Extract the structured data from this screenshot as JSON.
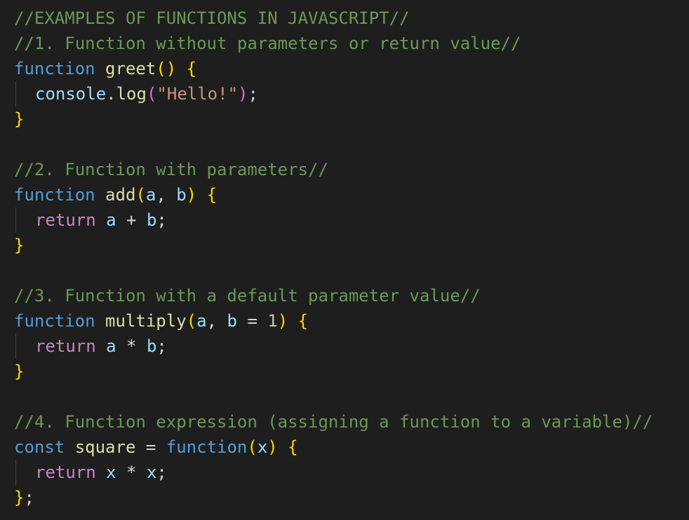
{
  "comments": {
    "title": "//EXAMPLES OF FUNCTIONS IN JAVASCRIPT//",
    "c1": "//1. Function without parameters or return value//",
    "c2": "//2. Function with parameters//",
    "c3": "//3. Function with a default parameter value//",
    "c4": "//4. Function expression (assigning a function to a variable)//"
  },
  "tokens": {
    "kw_function": "function",
    "kw_return": "return",
    "kw_const": "const",
    "fn_greet": "greet",
    "fn_add": "add",
    "fn_multiply": "multiply",
    "fn_square": "square",
    "var_console": "console",
    "fn_log": "log",
    "str_hello": "\"Hello!\"",
    "param_a": "a",
    "param_b": "b",
    "param_x": "x",
    "num_one": "1"
  },
  "colors": {
    "background": "#1e1e1e",
    "comment": "#6a9955",
    "keyword": "#569cd6",
    "control_keyword": "#c586c0",
    "function_name": "#dcdcaa",
    "variable": "#9cdcfe",
    "string": "#ce9178",
    "number": "#b5cea8",
    "bracket_level_1": "#ffd700",
    "bracket_level_2": "#da70d6"
  }
}
